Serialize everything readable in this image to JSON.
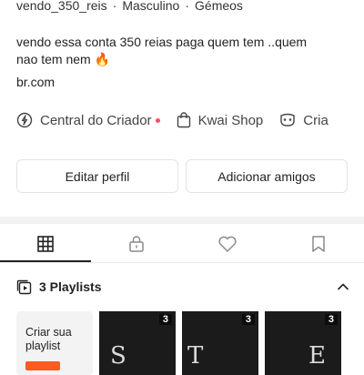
{
  "profile": {
    "username": "vendo_350_reis",
    "gender": "Masculino",
    "sign": "Gémeos",
    "bio_line1": "vendo essa conta 350 reias paga quem tem ..quem",
    "bio_line2": "nao tem nem 🔥",
    "link": "br.com"
  },
  "shortcuts": {
    "creator": "Central do Criador",
    "shop": "Kwai Shop",
    "third": "Cria"
  },
  "buttons": {
    "edit": "Editar perfil",
    "add_friends": "Adicionar amigos"
  },
  "tabs": [
    "grid",
    "lock",
    "heart",
    "bookmark"
  ],
  "playlists": {
    "header": "3 Playlists",
    "create_label_line1": "Criar sua",
    "create_label_line2": "playlist",
    "items": [
      {
        "count": "3",
        "letter": "S"
      },
      {
        "count": "3",
        "letter": "T"
      },
      {
        "count": "3",
        "letter": "E"
      }
    ]
  },
  "colors": {
    "notification_dot": "#ff4d5a",
    "accent_orange": "#ff5a1f"
  }
}
